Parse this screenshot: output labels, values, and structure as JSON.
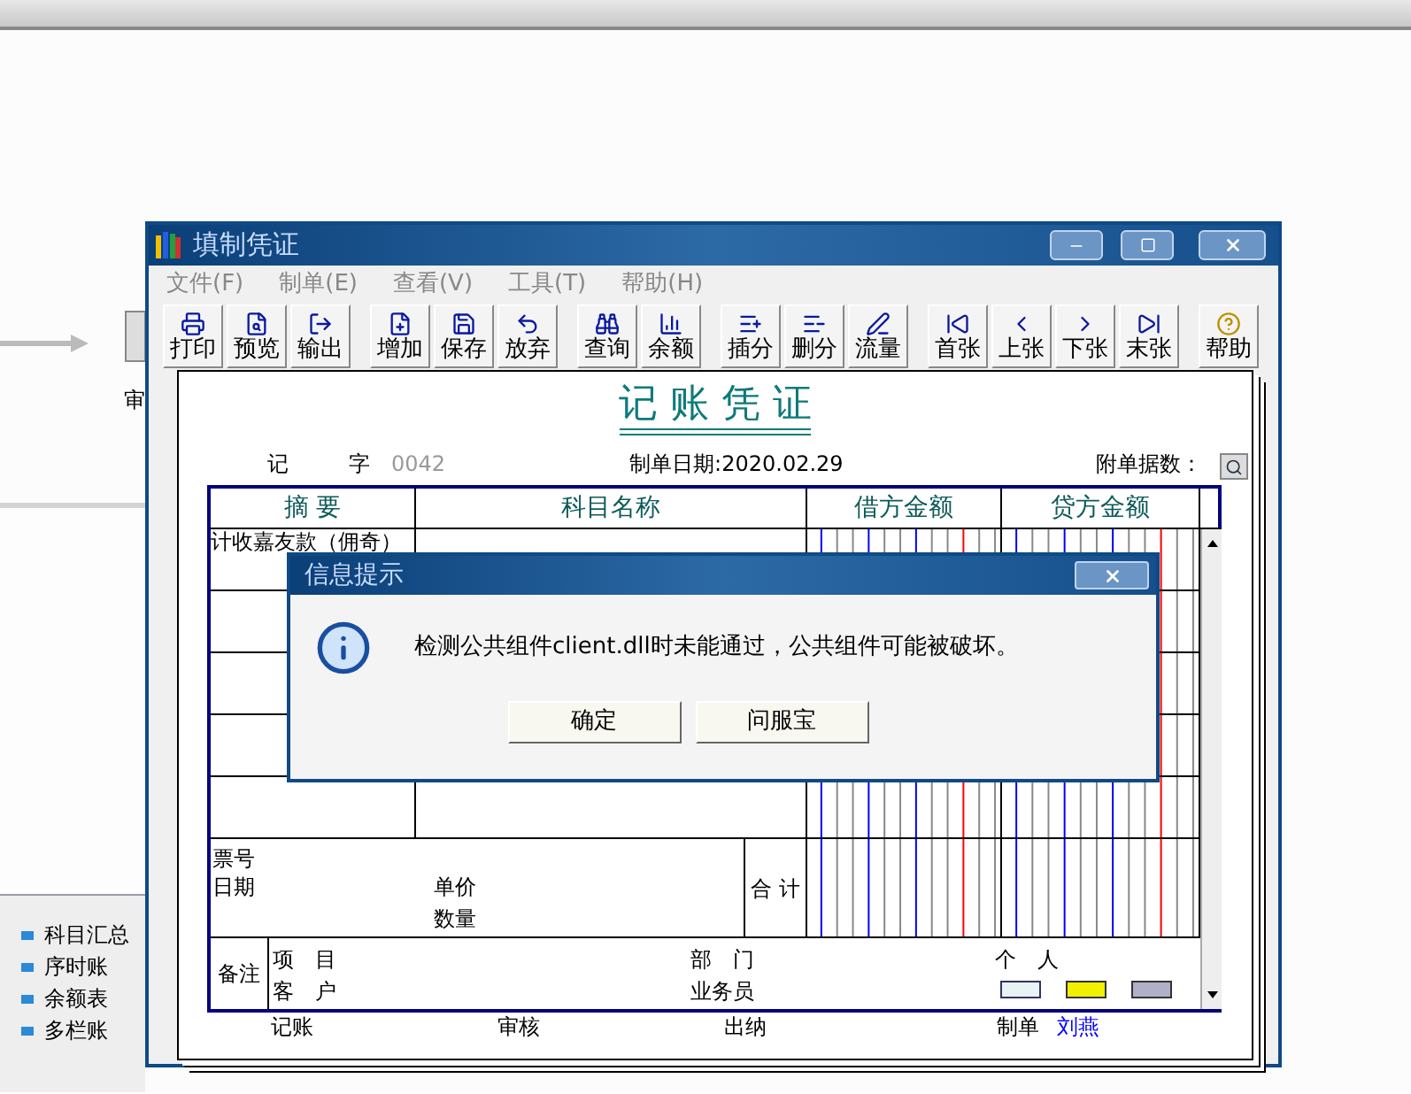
{
  "desktop": {
    "flow_label": "审",
    "links": [
      {
        "label": "科目汇总"
      },
      {
        "label": "序时账"
      },
      {
        "label": "余额表"
      },
      {
        "label": "多栏账"
      }
    ]
  },
  "window": {
    "title": "填制凭证",
    "menu": [
      "文件(F)",
      "制单(E)",
      "查看(V)",
      "工具(T)",
      "帮助(H)"
    ],
    "toolbar": [
      [
        {
          "label": "打印",
          "kind": "print"
        },
        {
          "label": "预览",
          "kind": "preview"
        },
        {
          "label": "输出",
          "kind": "export"
        }
      ],
      [
        {
          "label": "增加",
          "kind": "add"
        },
        {
          "label": "保存",
          "kind": "save"
        },
        {
          "label": "放弃",
          "kind": "undo"
        }
      ],
      [
        {
          "label": "查询",
          "kind": "find"
        },
        {
          "label": "余额",
          "kind": "chart"
        }
      ],
      [
        {
          "label": "插分",
          "kind": "insert"
        },
        {
          "label": "删分",
          "kind": "remove"
        },
        {
          "label": "流量",
          "kind": "edit"
        }
      ],
      [
        {
          "label": "首张",
          "kind": "first"
        },
        {
          "label": "上张",
          "kind": "prev"
        },
        {
          "label": "下张",
          "kind": "next"
        },
        {
          "label": "末张",
          "kind": "last"
        }
      ],
      [
        {
          "label": "帮助",
          "kind": "help"
        }
      ]
    ]
  },
  "voucher": {
    "title": "记 账 凭 证",
    "type_label": "记",
    "word_label": "字",
    "number": "0042",
    "date_label": "制单日期:",
    "date": "2020.02.29",
    "attachments_label": "附单据数：",
    "columns": [
      "摘 要",
      "科目名称",
      "借方金额",
      "贷方金额"
    ],
    "entries": [
      {
        "summary": "计收嘉友款（佣奇）"
      }
    ],
    "ticket_label": "票号",
    "date_field_label": "日期",
    "unit_price_label": "单价",
    "quantity_label": "数量",
    "total_label": "合 计",
    "remark_label": "备注",
    "project_label": "项　目",
    "customer_label": "客　户",
    "department_label": "部　门",
    "salesperson_label": "业务员",
    "person_label": "个　人",
    "signatures": [
      {
        "label": "记账"
      },
      {
        "label": "审核"
      },
      {
        "label": "出纳"
      },
      {
        "label": "制单",
        "value": "刘燕"
      }
    ]
  },
  "dialog": {
    "title": "信息提示",
    "message": "检测公共组件client.dll时未能通过，公共组件可能被破坏。",
    "buttons": [
      "确定",
      "问服宝"
    ]
  }
}
